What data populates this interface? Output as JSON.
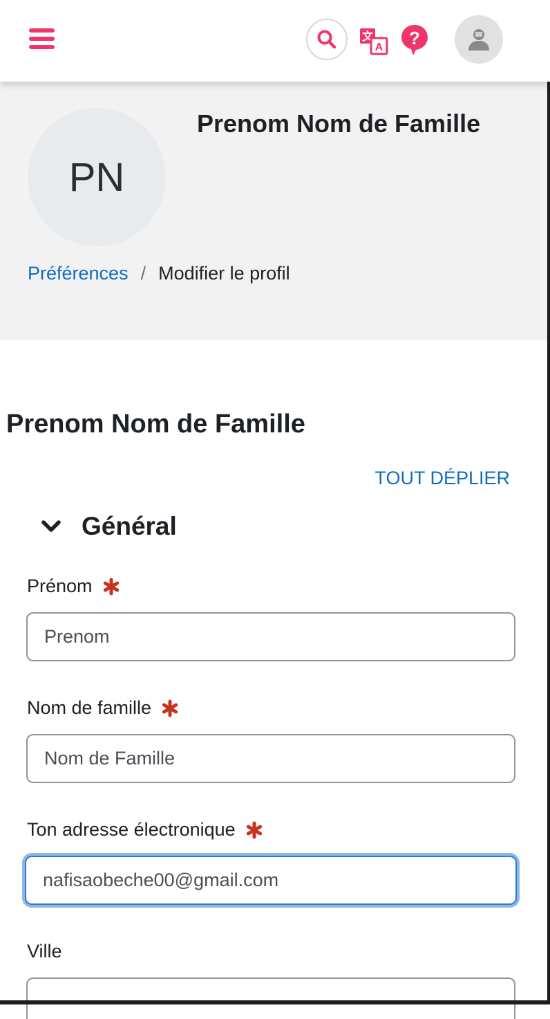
{
  "topbar": {
    "menu_icon": "hamburger-menu-icon",
    "search_icon": "search-icon",
    "translate_icon": "translate-icon",
    "help_icon": "help-icon",
    "user_icon": "user-avatar-icon",
    "accent_color": "#f0356b"
  },
  "profile": {
    "initials": "PN",
    "full_name": "Prenom Nom de Famille"
  },
  "breadcrumb": {
    "parent": "Préférences",
    "separator": "/",
    "current": "Modifier le profil"
  },
  "page": {
    "title": "Prenom Nom de Famille",
    "expand_all": "TOUT DÉPLIER"
  },
  "section": {
    "title": "Général",
    "icon": "chevron-down-icon"
  },
  "fields": {
    "firstname": {
      "label": "Prénom",
      "value": "Prenom",
      "required": true
    },
    "lastname": {
      "label": "Nom de famille",
      "value": "Nom de Famille",
      "required": true
    },
    "email": {
      "label": "Ton adresse électronique",
      "value": "nafisaobeche00@gmail.com",
      "required": true
    },
    "city": {
      "label": "Ville",
      "value": ""
    }
  },
  "colors": {
    "link": "#0f6cbf",
    "required": "#ca3120",
    "focus": "#2f7bd3",
    "header_bg": "#f2f2f2"
  }
}
